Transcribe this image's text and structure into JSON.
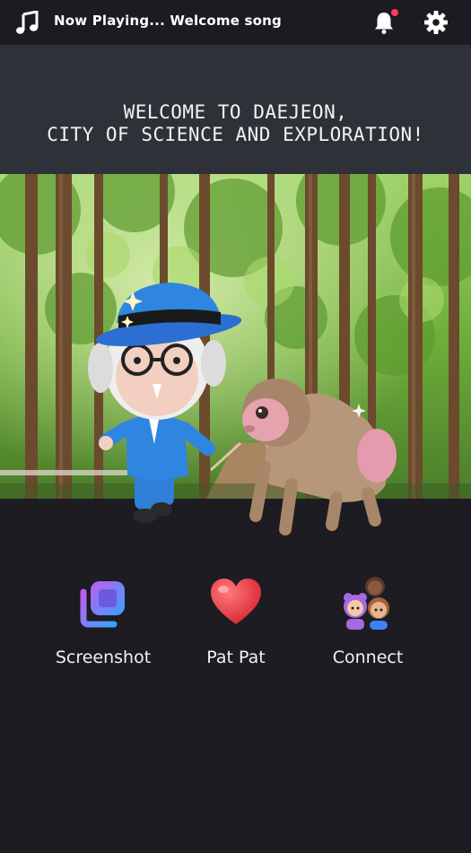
{
  "header": {
    "now_playing": "Now Playing... Welcome song",
    "icons": [
      "music-note-icon",
      "bell-icon",
      "gear-icon"
    ],
    "notification_dot_color": "#ff3b5c"
  },
  "banner": {
    "line1": "WELCOME TO DAEJEON,",
    "line2": "CITY OF SCIENCE AND EXPLORATION!"
  },
  "scene": {
    "description_icons": [
      "forest-background",
      "scientist-character",
      "monkey-character"
    ]
  },
  "actions": [
    {
      "label": "Screenshot",
      "icon": "screenshot-icon"
    },
    {
      "label": "Pat Pat",
      "icon": "heart-icon"
    },
    {
      "label": "Connect",
      "icon": "people-icon"
    }
  ]
}
